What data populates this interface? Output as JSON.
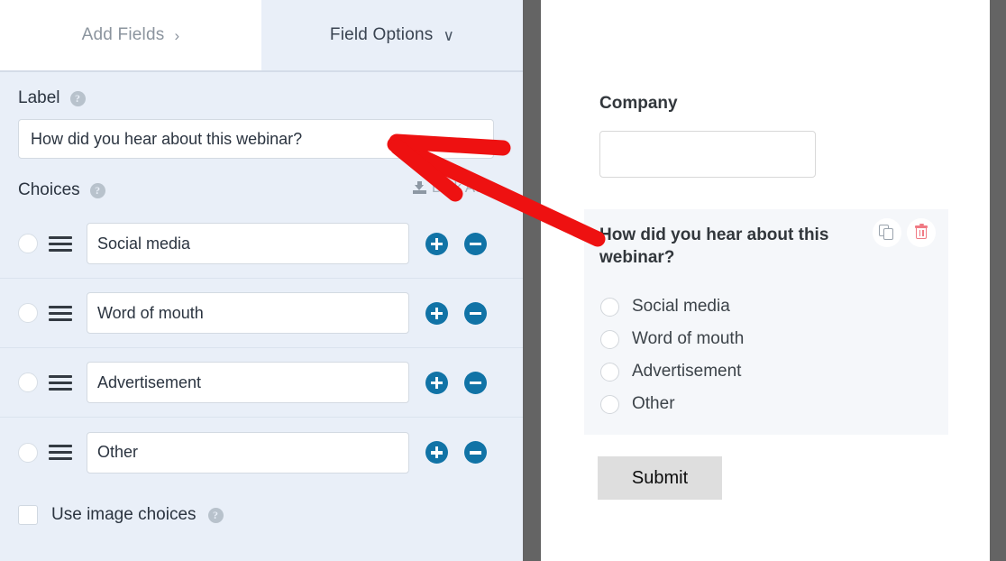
{
  "sidebar": {
    "tabs": [
      {
        "label": "Add Fields",
        "chevron": "›",
        "icon_name": "chevron-right-icon",
        "active": false
      },
      {
        "label": "Field Options",
        "chevron": "∨",
        "icon_name": "chevron-down-icon",
        "active": true
      }
    ],
    "label_section": {
      "title": "Label",
      "help_icon": "question-mark-icon",
      "value": "How did you hear about this webinar?"
    },
    "choices_section": {
      "title": "Choices",
      "help_icon": "question-mark-icon",
      "bulk_add_label": "Bulk Add",
      "bulk_add_icon": "import-download-icon",
      "rows": [
        {
          "value": "Social media",
          "add_label": "+",
          "remove_label": "−"
        },
        {
          "value": "Word of mouth",
          "add_label": "+",
          "remove_label": "−"
        },
        {
          "value": "Advertisement",
          "add_label": "+",
          "remove_label": "−"
        },
        {
          "value": "Other",
          "add_label": "+",
          "remove_label": "−"
        }
      ]
    },
    "image_choices": {
      "label": "Use image choices",
      "checked": false,
      "help_icon": "question-mark-icon"
    }
  },
  "preview": {
    "company_field": {
      "label": "Company",
      "value": ""
    },
    "selected_field": {
      "label": "How did you hear about this webinar?",
      "options": [
        "Social media",
        "Word of mouth",
        "Advertisement",
        "Other"
      ],
      "duplicate_icon": "copy-icon",
      "delete_icon": "trash-icon"
    },
    "submit_label": "Submit"
  },
  "colors": {
    "sidebar_bg": "#e9eff8",
    "active_tab_bg": "#e9eff8",
    "inactive_tab_bg": "#ffffff",
    "accent_blue": "#1173a6",
    "gutter_gray": "#646464",
    "card_bg": "#f5f7fa",
    "submit_bg": "#dedede",
    "trash_red": "#f07a84",
    "annotation_red": "#ee1111"
  }
}
